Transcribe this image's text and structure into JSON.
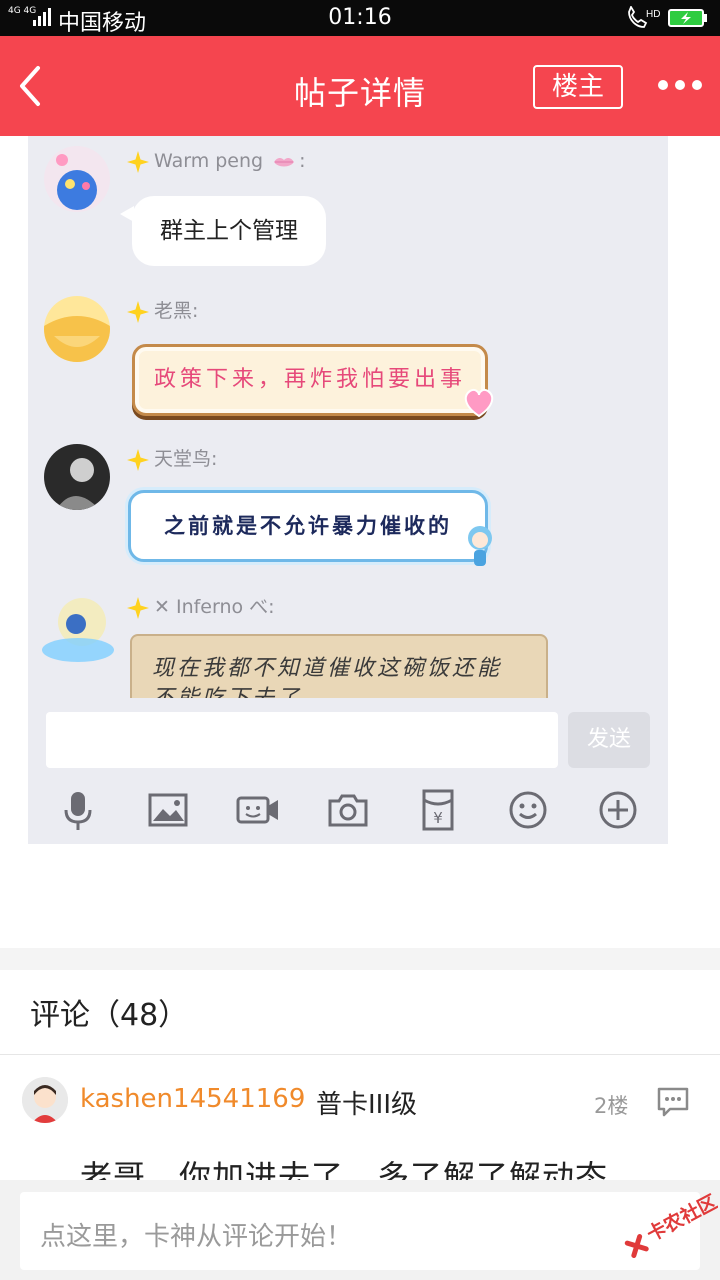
{
  "status_bar": {
    "network_top": "4G 4G",
    "carrier": "中国移动",
    "time": "01:16",
    "hd_label": "HD",
    "icons": [
      "signal-icon",
      "call-hd-icon",
      "battery-charging-icon"
    ]
  },
  "nav": {
    "back_icon": "chevron-left-icon",
    "title": "帖子详情",
    "op_button": "楼主",
    "more_icon": "more-dots-icon"
  },
  "post_image": {
    "messages": [
      {
        "sender": "Warm peng",
        "sender_suffix": ":",
        "text": "群主上个管理"
      },
      {
        "sender": "老黑:",
        "text": "政策下来，再炸我怕要出事"
      },
      {
        "sender": "天堂鸟:",
        "text": "之前就是不允许暴力催收的"
      },
      {
        "sender": "✕ Inferno べ:",
        "text_line1": "现在我都不知道催收这碗饭还能",
        "text_line2": "不能吃下去了"
      }
    ],
    "send_label": "发送",
    "toolbar_icons": [
      "microphone-icon",
      "image-icon",
      "video-icon",
      "camera-icon",
      "red-packet-icon",
      "emoji-icon",
      "plus-icon"
    ]
  },
  "comments": {
    "header": "评论（48）",
    "items": [
      {
        "username": "kashen14541169",
        "level": "普卡III级",
        "floor": "2楼",
        "text": "老哥，你加进去了，多了解了解动态"
      }
    ]
  },
  "bottom": {
    "placeholder": "点这里，卡神从评论开始！",
    "watermark": "卡农社区"
  },
  "colors": {
    "nav_bg": "#f5454f",
    "username": "#f08a2b"
  }
}
